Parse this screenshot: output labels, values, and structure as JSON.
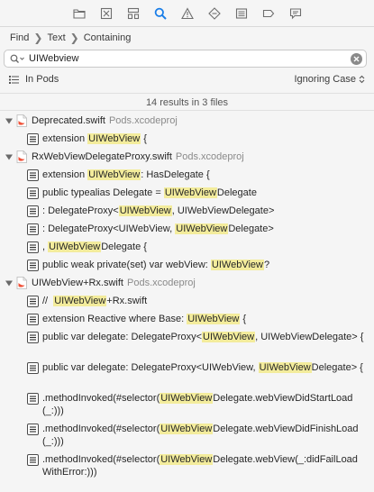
{
  "navigator": {
    "icons": [
      "folder-icon",
      "source-control-icon",
      "hierarchy-icon",
      "search-icon",
      "issue-warning-icon",
      "test-diamond-icon",
      "debug-list-icon",
      "breakpoint-tag-icon",
      "report-comment-icon"
    ],
    "active_color": "#1a7ee8",
    "inactive_color": "#6e6e6e"
  },
  "breadcrumb": [
    "Find",
    "Text",
    "Containing"
  ],
  "search": {
    "value": "UIWebview",
    "placeholder": ""
  },
  "scope": {
    "label": "In Pods"
  },
  "case_option": {
    "label": "Ignoring Case"
  },
  "summary": "14 results in 3 files",
  "highlight_color": "#f3ec9c",
  "files": [
    {
      "name": "Deprecated.swift",
      "project": "Pods.xcodeproj",
      "matches": [
        [
          [
            "extension "
          ],
          [
            "UIWebView",
            true
          ],
          [
            " {"
          ]
        ]
      ]
    },
    {
      "name": "RxWebViewDelegateProxy.swift",
      "project": "Pods.xcodeproj",
      "matches": [
        [
          [
            "extension "
          ],
          [
            "UIWebView",
            true
          ],
          [
            ": HasDelegate {"
          ]
        ],
        [
          [
            "public typealias Delegate = "
          ],
          [
            "UIWebView",
            true
          ],
          [
            "Delegate"
          ]
        ],
        [
          [
            ": DelegateProxy<"
          ],
          [
            "UIWebView",
            true
          ],
          [
            ", UIWebViewDelegate>"
          ]
        ],
        [
          [
            ": DelegateProxy<UIWebView, "
          ],
          [
            "UIWebView",
            true
          ],
          [
            "Delegate>"
          ]
        ],
        [
          [
            ", "
          ],
          [
            "UIWebView",
            true
          ],
          [
            "Delegate {"
          ]
        ],
        [
          [
            "public weak private(set) var webView: "
          ],
          [
            "UIWebView",
            true
          ],
          [
            "?"
          ]
        ]
      ]
    },
    {
      "name": "UIWebView+Rx.swift",
      "project": "Pods.xcodeproj",
      "matches": [
        [
          [
            "//  "
          ],
          [
            "UIWebView",
            true
          ],
          [
            "+Rx.swift"
          ]
        ],
        [
          [
            "extension Reactive where Base: "
          ],
          [
            "UIWebView",
            true
          ],
          [
            " {"
          ]
        ],
        [
          [
            "public var delegate: DelegateProxy<"
          ],
          [
            "UIWebView",
            true
          ],
          [
            ", UIWebViewDelegate> {"
          ]
        ],
        [
          [
            "public var delegate: DelegateProxy<UIWebView, "
          ],
          [
            "UIWebView",
            true
          ],
          [
            "Delegate> {"
          ]
        ],
        [
          [
            ".methodInvoked(#selector("
          ],
          [
            "UIWebView",
            true
          ],
          [
            "Delegate.webViewDidStartLoad(_:)))"
          ]
        ],
        [
          [
            ".methodInvoked(#selector("
          ],
          [
            "UIWebView",
            true
          ],
          [
            "Delegate.webViewDidFinishLoad(_:)))"
          ]
        ],
        [
          [
            ".methodInvoked(#selector("
          ],
          [
            "UIWebView",
            true
          ],
          [
            "Delegate.webView(_:didFailLoadWithError:)))"
          ]
        ]
      ]
    }
  ]
}
